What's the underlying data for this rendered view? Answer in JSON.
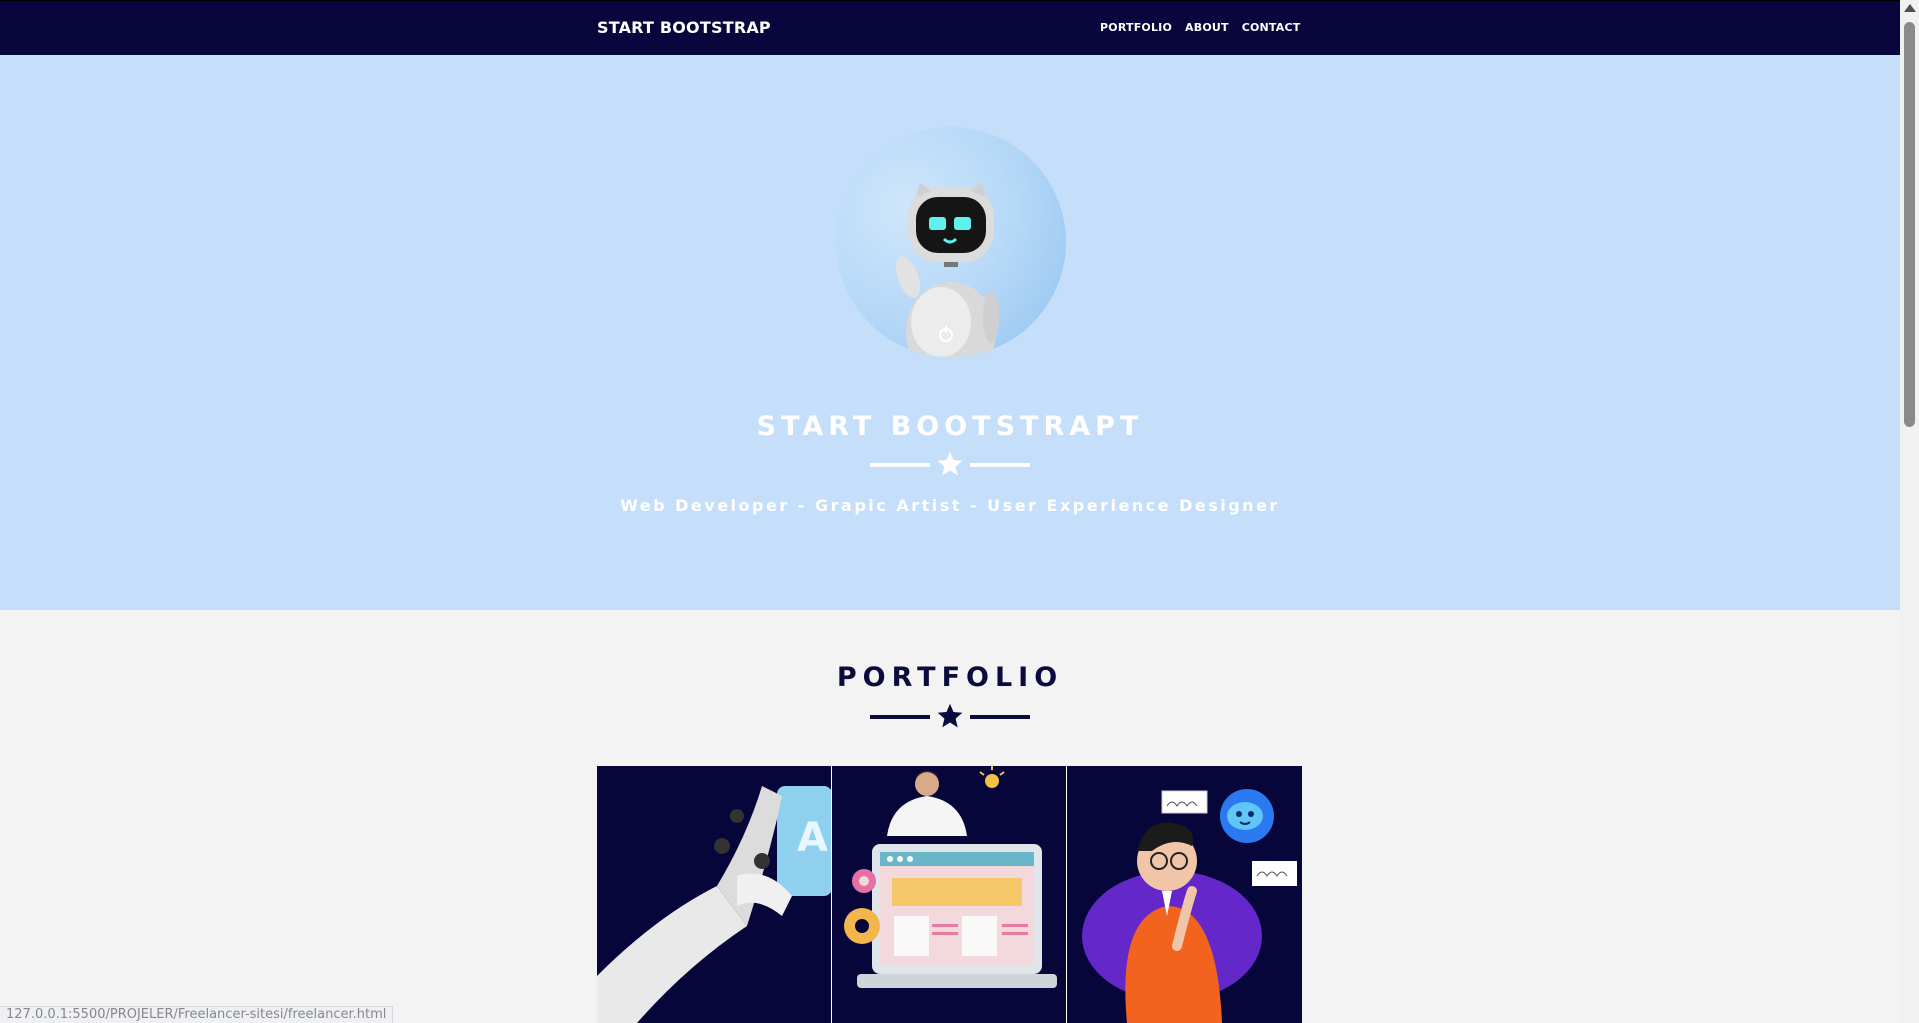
{
  "navbar": {
    "brand": "START BOOTSTRAP",
    "links": [
      "PORTFOLIO",
      "ABOUT",
      "CONTACT"
    ]
  },
  "hero": {
    "title": "START BOOTSTRAPT",
    "subtitle": "Web Developer - Grapic Artist - User Experience Designer",
    "avatar_icon": "robot-avatar-icon",
    "divider_icon": "star-icon"
  },
  "portfolio": {
    "title": "PORTFOLIO",
    "divider_icon": "star-icon",
    "items": [
      {
        "icon": "robot-hand-illustration"
      },
      {
        "icon": "web-developer-laptop-illustration"
      },
      {
        "icon": "thinking-man-robot-illustration"
      }
    ]
  },
  "status_bar": {
    "url": "127.0.0.1:5500/PROJELER/Freelancer-sitesi/freelancer.html"
  },
  "colors": {
    "navbar": "#08063d",
    "hero_bg": "#c5dffb",
    "page_bg": "#f3f3f3",
    "accent_dark": "#0b0a3d",
    "white": "#ffffff"
  }
}
